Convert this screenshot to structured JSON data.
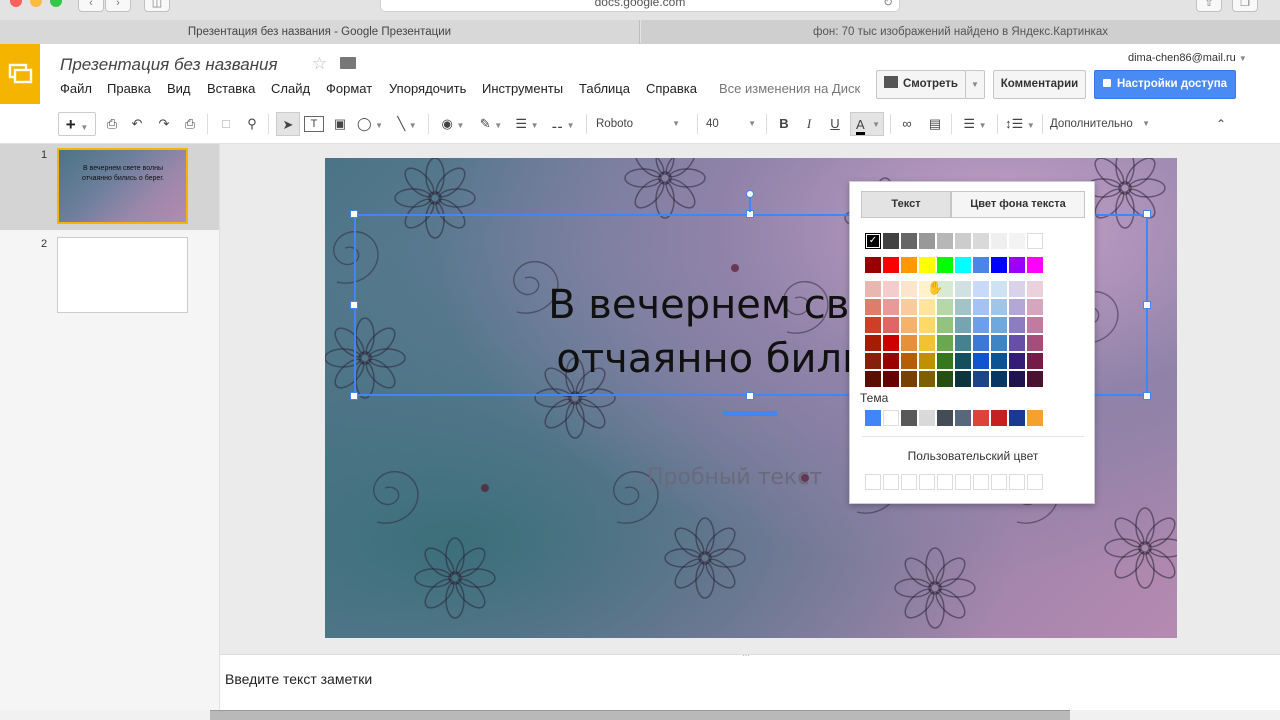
{
  "browser": {
    "url": "docs.google.com",
    "tabs": [
      "Презентация без названия - Google Презентации",
      "фон: 70 тыс изображений найдено в Яндекс.Картинках"
    ]
  },
  "header": {
    "doc_title": "Презентация без названия",
    "menu": [
      "Файл",
      "Правка",
      "Вид",
      "Вставка",
      "Слайд",
      "Формат",
      "Упорядочить",
      "Инструменты",
      "Таблица",
      "Справка"
    ],
    "save_status": "Все изменения на Диске сохранены",
    "user_email": "dima-chen86@mail.ru",
    "present_label": "Смотреть",
    "comments_label": "Комментарии",
    "share_label": "Настройки доступа"
  },
  "toolbar": {
    "font": "Roboto",
    "font_size": "40",
    "bold": "B",
    "italic": "I",
    "underline": "U",
    "text_color": "A",
    "more": "Дополнительно"
  },
  "filmstrip": {
    "slides": [
      {
        "number": "1",
        "thumb_text": "В вечернем свете волны отчаянно бились о берег."
      },
      {
        "number": "2",
        "thumb_text": ""
      }
    ]
  },
  "slide": {
    "title_line1": "В вечернем свете",
    "title_line2": "отчаянно бились",
    "body_text": "Пробный текст"
  },
  "notes": {
    "placeholder": "Введите текст заметки"
  },
  "color_picker": {
    "tab_text": "Текст",
    "tab_background": "Цвет фона текста",
    "theme_label": "Тема",
    "custom_label": "Пользовательский цвет",
    "grays": [
      "#000000",
      "#434343",
      "#666666",
      "#999999",
      "#b7b7b7",
      "#cccccc",
      "#d9d9d9",
      "#efefef",
      "#f3f3f3",
      "#ffffff"
    ],
    "brights": [
      "#980000",
      "#ff0000",
      "#ff9900",
      "#ffff00",
      "#00ff00",
      "#00ffff",
      "#4a86e8",
      "#0000ff",
      "#9900ff",
      "#ff00ff"
    ],
    "palette_rows": [
      [
        "#e6b8af",
        "#f4cccc",
        "#fce5cd",
        "#fff2cc",
        "#d9ead3",
        "#d0e0e3",
        "#c9daf8",
        "#cfe2f3",
        "#d9d2e9",
        "#ead1dc"
      ],
      [
        "#dd7e6b",
        "#ea9999",
        "#f9cb9c",
        "#ffe599",
        "#b6d7a8",
        "#a2c4c9",
        "#a4c2f4",
        "#9fc5e8",
        "#b4a7d6",
        "#d5a6bd"
      ],
      [
        "#cc4125",
        "#e06666",
        "#f6b26b",
        "#ffd966",
        "#93c47d",
        "#76a5af",
        "#6d9eeb",
        "#6fa8dc",
        "#8e7cc3",
        "#c27ba0"
      ],
      [
        "#a61c00",
        "#cc0000",
        "#e69138",
        "#f1c232",
        "#6aa84f",
        "#45818e",
        "#3c78d8",
        "#3d85c6",
        "#674ea7",
        "#a64d79"
      ],
      [
        "#85200c",
        "#990000",
        "#b45f06",
        "#bf9000",
        "#38761d",
        "#134f5c",
        "#1155cc",
        "#0b5394",
        "#351c75",
        "#741b47"
      ],
      [
        "#5b0f00",
        "#660000",
        "#783f04",
        "#7f6000",
        "#274e13",
        "#0c343d",
        "#1c4587",
        "#073763",
        "#20124d",
        "#4c1130"
      ]
    ],
    "theme_colors": [
      "#4285f4",
      "#ffffff",
      "#595959",
      "#d9d9d9",
      "#434c57",
      "#56687a",
      "#db4437",
      "#c5221f",
      "#1a3a8f",
      "#f4a12f"
    ]
  }
}
